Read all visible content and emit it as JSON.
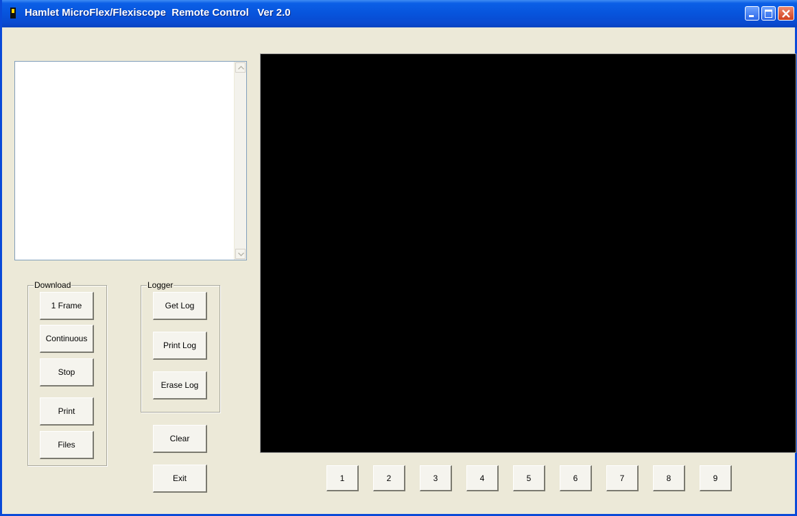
{
  "window": {
    "title": "Hamlet MicroFlex/Flexiscope  Remote Control   Ver 2.0"
  },
  "download_group": {
    "label": "Download",
    "frame_label": "1 Frame",
    "continuous_label": "Continuous",
    "stop_label": "Stop",
    "print_label": "Print",
    "files_label": "Files"
  },
  "logger_group": {
    "label": "Logger",
    "get_log_label": "Get Log",
    "print_log_label": "Print Log",
    "erase_log_label": "Erase Log"
  },
  "actions": {
    "clear_label": "Clear",
    "exit_label": "Exit"
  },
  "channel_buttons": [
    "1",
    "2",
    "3",
    "4",
    "5",
    "6",
    "7",
    "8",
    "9"
  ],
  "colors": {
    "titlebar": "#0754dc",
    "face": "#ece9d8",
    "display": "#000000"
  },
  "icons": [
    "app-icon",
    "minimize-icon",
    "maximize-icon",
    "close-icon",
    "scroll-up-arrow-icon",
    "scroll-down-arrow-icon"
  ]
}
